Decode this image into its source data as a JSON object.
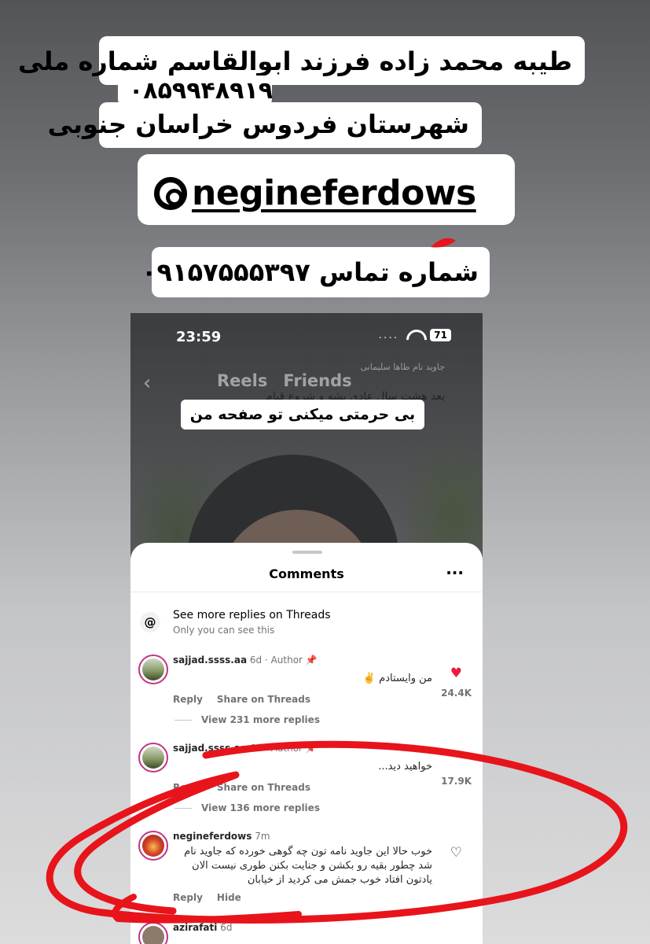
{
  "captions": {
    "line1": "طیبه محمد زاده فرزند ابوالقاسم شماره ملی",
    "national_id": "۰۸۵۹۹۴۸۹۱۹",
    "line3": "شهرستان فردوس خراسان جنوبی",
    "handle": "negineferdows",
    "phone_label": "شماره تماس ۰۹۱۵۷۵۵۵۳۹۷"
  },
  "status_bar": {
    "time": "23:59",
    "dots": "....",
    "battery": "71"
  },
  "reel": {
    "tab_reels": "Reels",
    "tab_friends": "Friends",
    "overlay_top": "جاوید نام طاها سلیمانی",
    "overlay_text": "بعد هشت سال عادی بشه و شروع قیام",
    "sticker_text": "بی حرمتی میکنی تو صفحه من"
  },
  "comments_sheet": {
    "title": "Comments",
    "more_icon": "more-dots-icon",
    "threads_prompt": {
      "title": "See more replies on Threads",
      "subtitle": "Only you can see this"
    },
    "comments": [
      {
        "user": "sajjad.ssss.aa",
        "meta": "6d · Author",
        "text": "من وایستادم ✌️",
        "reply": "Reply",
        "share": "Share on Threads",
        "likes": "24.4K",
        "liked": true,
        "view_replies": "View 231 more replies"
      },
      {
        "user": "sajjad.ssss.aa",
        "meta": "6d · Author",
        "text": "خواهید دید...",
        "reply": "Reply",
        "share": "Share on Threads",
        "likes": "17.9K",
        "liked": false,
        "view_replies": "View 136 more replies"
      },
      {
        "user": "negineferdows",
        "meta": "7m",
        "text": "خوب حالا این جاوید نامه تون چه گوهی خورده که جاوید نام شد چطور بقیه رو بکشن و جنایت بکنن طوری نیست الان یادتون افتاد خوب جمش می کردید از خیابان",
        "reply": "Reply",
        "hide": "Hide"
      },
      {
        "user": "azirafati",
        "meta": "6d"
      }
    ]
  },
  "colors": {
    "annotation_red": "#e8141b",
    "like_red": "#ed1c3f",
    "avatar_ring": "#c13584"
  }
}
